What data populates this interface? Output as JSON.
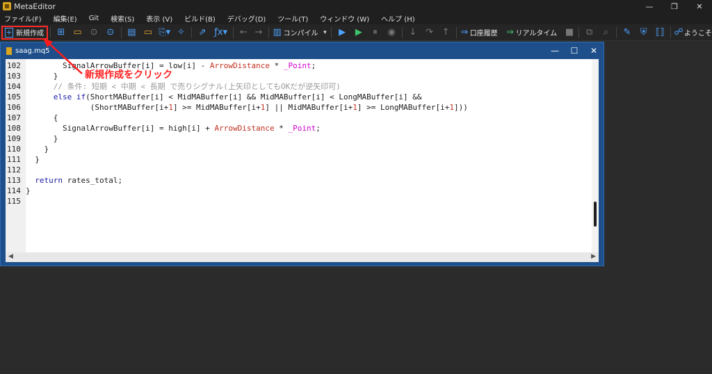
{
  "window": {
    "title": "MetaEditor"
  },
  "menu": [
    "ファイル(F)",
    "編集(E)",
    "Git",
    "検索(S)",
    "表示 (V)",
    "ビルド(B)",
    "デバッグ(D)",
    "ツール(T)",
    "ウィンドウ (W)",
    "ヘルプ (H)"
  ],
  "toolbar": {
    "new_label": "新規作成",
    "compile_label": "コンパイル",
    "history_label": "口座履歴",
    "realtime_label": "リアルタイム",
    "welcome_label": "ようこそ"
  },
  "document": {
    "filename": "saag.mq5"
  },
  "annotation": "新規作成をクリック",
  "code_lines": [
    {
      "n": "102",
      "segs": [
        [
          "",
          "        SignalArrowBuffer[i] = low[i] - "
        ],
        [
          "mac",
          "ArrowDistance"
        ],
        [
          "",
          " * "
        ],
        [
          "pt",
          "_Point"
        ],
        [
          "",
          ";"
        ]
      ]
    },
    {
      "n": "103",
      "segs": [
        [
          "",
          "      }"
        ]
      ]
    },
    {
      "n": "104",
      "segs": [
        [
          "cm",
          "      // 条件: 短期 < 中期 < 長期 で売りシグナル(上矢印としてもOKだが逆矢印可)"
        ]
      ]
    },
    {
      "n": "105",
      "segs": [
        [
          "kw",
          "      else if"
        ],
        [
          "",
          "(ShortMABuffer[i] < MidMABuffer[i] && MidMABuffer[i] < LongMABuffer[i] &&"
        ]
      ]
    },
    {
      "n": "106",
      "segs": [
        [
          "",
          "              (ShortMABuffer[i+"
        ],
        [
          "mac",
          "1"
        ],
        [
          "",
          "] >= MidMABuffer[i+"
        ],
        [
          "mac",
          "1"
        ],
        [
          "",
          "] || MidMABuffer[i+"
        ],
        [
          "mac",
          "1"
        ],
        [
          "",
          "] >= LongMABuffer[i+"
        ],
        [
          "mac",
          "1"
        ],
        [
          "",
          "]))"
        ]
      ]
    },
    {
      "n": "107",
      "segs": [
        [
          "",
          "      {"
        ]
      ]
    },
    {
      "n": "108",
      "segs": [
        [
          "",
          "        SignalArrowBuffer[i] = high[i] + "
        ],
        [
          "mac",
          "ArrowDistance"
        ],
        [
          "",
          " * "
        ],
        [
          "pt",
          "_Point"
        ],
        [
          "",
          ";"
        ]
      ]
    },
    {
      "n": "109",
      "segs": [
        [
          "",
          "      }"
        ]
      ]
    },
    {
      "n": "110",
      "segs": [
        [
          "",
          "    }"
        ]
      ]
    },
    {
      "n": "111",
      "segs": [
        [
          "",
          "  }"
        ]
      ]
    },
    {
      "n": "112",
      "segs": [
        [
          "",
          ""
        ]
      ]
    },
    {
      "n": "113",
      "segs": [
        [
          "kw",
          "  return"
        ],
        [
          "",
          " rates_total;"
        ]
      ]
    },
    {
      "n": "114",
      "segs": [
        [
          "",
          "}"
        ]
      ]
    },
    {
      "n": "115",
      "segs": [
        [
          "",
          ""
        ]
      ]
    }
  ]
}
